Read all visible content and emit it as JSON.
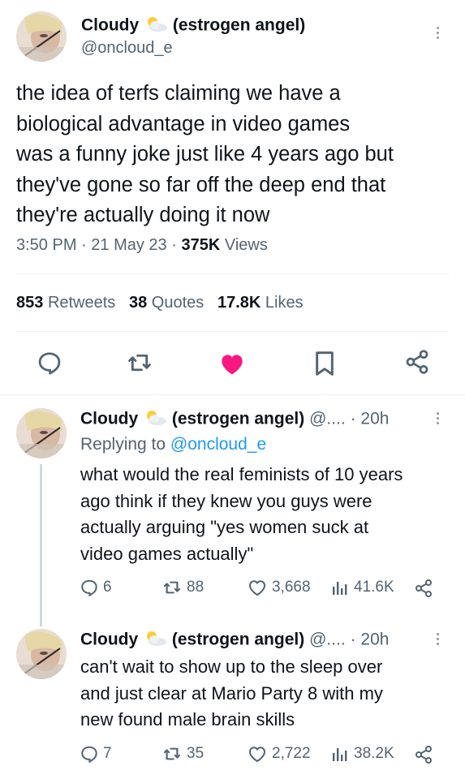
{
  "main_tweet": {
    "display_name": "Cloudy",
    "name_suffix": "(estrogen angel)",
    "handle": "@oncloud_e",
    "text_lines": [
      "the idea of terfs claiming we have a",
      "biological advantage in video games",
      "was a funny joke just like 4 years ago but",
      "they've gone so far off the deep end that",
      "they're actually doing it now"
    ],
    "time": "3:50 PM",
    "date": "21 May 23",
    "views_count": "375K",
    "views_label": "Views",
    "retweets_count": "853",
    "retweets_label": "Retweets",
    "quotes_count": "38",
    "quotes_label": "Quotes",
    "likes_count": "17.8K",
    "likes_label": "Likes",
    "icons": [
      "reply-icon",
      "retweet-icon",
      "like-icon-filled",
      "bookmark-icon",
      "share-icon"
    ],
    "like_color": "#f91880"
  },
  "replies": [
    {
      "display_name": "Cloudy",
      "name_suffix": "(estrogen angel)",
      "handle_trunc": "@....",
      "time_ago": "20h",
      "replying_to_label": "Replying to",
      "replying_to_handle": "@oncloud_e",
      "text_lines": [
        "what would the real feminists of 10 years",
        "ago think if they knew you guys were",
        "actually arguing \"yes women suck at",
        "video games actually\""
      ],
      "reply_count": "6",
      "retweet_count": "88",
      "like_count": "3,668",
      "view_count": "41.6K"
    },
    {
      "display_name": "Cloudy",
      "name_suffix": "(estrogen angel)",
      "handle_trunc": "@....",
      "time_ago": "20h",
      "text_lines": [
        "can't wait to show up to the sleep over",
        "and just clear at Mario Party 8 with my",
        "new found male brain skills"
      ],
      "reply_count": "7",
      "retweet_count": "35",
      "like_count": "2,722",
      "view_count": "38.2K"
    }
  ],
  "dot_sep": "·",
  "colors": {
    "accent": "#1d9bf0",
    "secondary_text": "#536471",
    "thread_line": "#cfd9de"
  }
}
